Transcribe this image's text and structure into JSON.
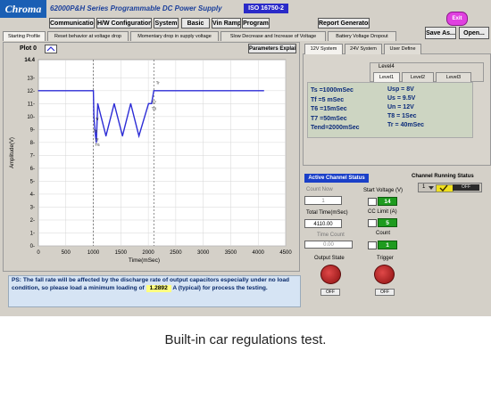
{
  "header": {
    "brand": "Chroma",
    "title": "62000P&H Series  Programmable DC Power Supply",
    "iso": "ISO 16750-2",
    "menu": [
      "Communication",
      "H/W Configuration",
      "System",
      "Basic",
      "Vin Ramp",
      "Program"
    ],
    "report_button": "Report Generator",
    "exit_button": "Exit",
    "save_as_button": "Save As...",
    "open_button": "Open..."
  },
  "tabs": [
    "Starting Profile",
    "Reset behavior at voltage drop",
    "Momentary drop in supply voltage",
    "Slow Decrease and Increase of Voltage",
    "Battery Voltage Dropout"
  ],
  "plot": {
    "selector_label": "Plot 0",
    "params_button": "Parameters Explain",
    "y_axis_label": "Amplitude(V)",
    "x_axis_label": "Time(mSec)",
    "y_ticks": [
      "14.4",
      "13-",
      "12-",
      "11-",
      "10-",
      "9-",
      "8-",
      "7-",
      "6-",
      "5-",
      "4-",
      "3-",
      "2-",
      "1-",
      "0-"
    ],
    "x_ticks": [
      "0",
      "500",
      "1000",
      "1500",
      "2000",
      "2500",
      "3000",
      "3500",
      "4000",
      "4500"
    ],
    "markers": [
      "Tr",
      "Ts",
      "Tf",
      "T6",
      "T7",
      "T8",
      "Tr"
    ]
  },
  "chart_data": {
    "type": "line",
    "x": [
      0,
      1000,
      1005,
      1010,
      1020,
      1040,
      1055,
      1080,
      1230,
      1380,
      1530,
      1680,
      1830,
      2005,
      2060,
      2100,
      4100
    ],
    "y": [
      12,
      12,
      11,
      10,
      9.5,
      8.5,
      8,
      11,
      8.5,
      11,
      8.5,
      11,
      8.5,
      11,
      11,
      12,
      12
    ],
    "xlabel": "Time(mSec)",
    "ylabel": "Amplitude(V)",
    "xlim": [
      0,
      4500
    ],
    "ylim": [
      0,
      14.4
    ],
    "grid": true
  },
  "note": {
    "text_part1": "PS: The fall rate will be affected by the discharge rate of output capacitors especially under no load condition, so please load a minimum loading of",
    "value": "1.2892",
    "text_part2": "A (typical) for process the testing."
  },
  "system_tabs": [
    "12V System",
    "24V System",
    "User Define"
  ],
  "level_group": {
    "title": "Level4",
    "tabs": [
      "Level1",
      "Level2",
      "Level3"
    ]
  },
  "params_left": [
    "Ts    =1000mSec",
    "Tf     =5 mSec",
    "T6    =15mSec",
    "T7    =50mSec",
    "Tend=2000mSec"
  ],
  "params_right": [
    "Usp   = 8V",
    "Us     = 9.5V",
    "Un     = 12V",
    "T8     = 1Sec",
    "Tr      = 40mSec"
  ],
  "active_status": {
    "title": "Active Channel Status",
    "count_now_label": "Count Now",
    "count_now_value": "1",
    "total_time_label": "Total Time(mSec)",
    "total_time_value": "4110.00",
    "time_count_label": "Time Count",
    "time_count_value": "0.00",
    "start_voltage_label": "Start Voltage (V)",
    "start_voltage_value": "14",
    "cc_limit_label": "CC Limit (A)",
    "cc_limit_value": "5",
    "count_label": "Count",
    "count_value": "1"
  },
  "channel_running": {
    "title": "Channel Running Status",
    "channel": "1",
    "state": "OFF"
  },
  "output_state": {
    "label": "Output State",
    "state": "OFF"
  },
  "trigger": {
    "label": "Trigger",
    "state": "OFF"
  },
  "caption": "Built-in car regulations test.",
  "colors": {
    "panel": "#d4d0c8",
    "brand_blue": "#1a5fb4",
    "line": "#2d2dd6",
    "accent_green": "#1e9b1e",
    "exit_magenta": "#e040e0"
  }
}
